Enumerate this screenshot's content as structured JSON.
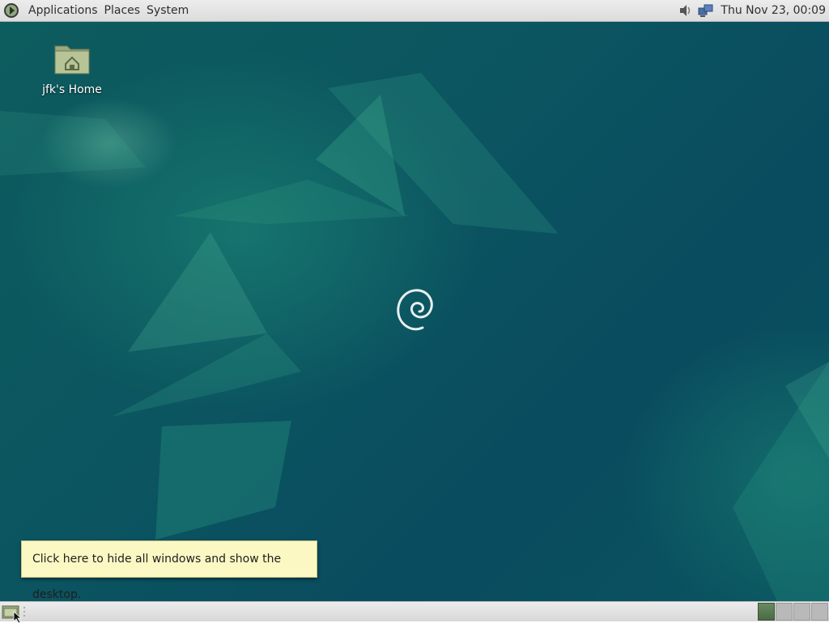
{
  "top_panel": {
    "menus": [
      "Applications",
      "Places",
      "System"
    ],
    "logo_icon": "debian-menu-icon",
    "tray_icons": [
      "volume-icon",
      "network-icon"
    ],
    "clock": "Thu Nov 23, 00:09"
  },
  "desktop": {
    "home_icon": {
      "label": "jfk's Home",
      "icon": "home-folder-icon"
    },
    "logo": "debian-swirl-logo"
  },
  "tooltip": {
    "text": "Click here to hide all windows and show the desktop."
  },
  "bottom_panel": {
    "show_desktop_icon": "show-desktop-icon",
    "workspaces": [
      {
        "active": true
      },
      {
        "active": false
      },
      {
        "active": false
      },
      {
        "active": false
      }
    ]
  },
  "colors": {
    "panel": "#e3e3e3",
    "desktop_base": "#0b5560",
    "tooltip_bg": "#fbf8c4",
    "active_workspace": "#5a7a54"
  }
}
